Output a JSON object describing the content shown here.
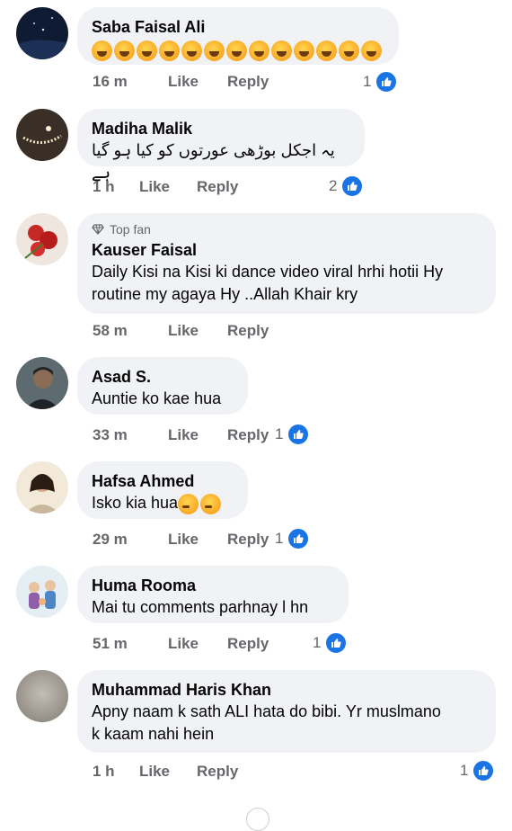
{
  "comments": [
    {
      "name": "Saba Faisal Ali",
      "text": "",
      "emoji_count": 13,
      "time": "16 m",
      "like": "Like",
      "reply": "Reply",
      "reactions": "1"
    },
    {
      "name": "Madiha Malik",
      "text": "یہ اجکل بوڑھی عورتوں کو کیا ہو گیا ہے",
      "time": "1 h",
      "like": "Like",
      "reply": "Reply",
      "reactions": "2"
    },
    {
      "badge": "Top fan",
      "name": "Kauser Faisal",
      "text_line1": "Daily Kisi na Kisi ki dance video viral hrhi hotii Hy",
      "text_line2": "routine my agaya Hy ..Allah Khair kry",
      "time": "58 m",
      "like": "Like",
      "reply": "Reply"
    },
    {
      "name": "Asad S.",
      "text": "Auntie ko kae hua",
      "time": "33 m",
      "like": "Like",
      "reply": "Reply",
      "reactions": "1"
    },
    {
      "name": "Hafsa Ahmed",
      "text": "Isko kia hua",
      "time": "29 m",
      "like": "Like",
      "reply": "Reply",
      "reactions": "1"
    },
    {
      "name": "Huma Rooma",
      "text": "Mai tu comments parhnay l hn",
      "time": "51 m",
      "like": "Like",
      "reply": "Reply",
      "reactions": "1"
    },
    {
      "name": "Muhammad Haris Khan",
      "text_line1": "Apny naam k sath ALI hata do bibi. Yr muslmano",
      "text_line2": "k kaam nahi hein",
      "time": "1 h",
      "like": "Like",
      "reply": "Reply",
      "reactions": "1"
    }
  ],
  "colors": {
    "like_blue": "#1b74e4",
    "bubble": "#f0f2f5",
    "meta_gray": "#65676b"
  }
}
